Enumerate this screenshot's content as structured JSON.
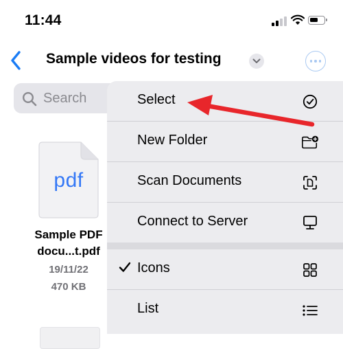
{
  "status_bar": {
    "time": "11:44"
  },
  "nav": {
    "title": "Sample videos for testing",
    "icons": {
      "back": "chevron-left-icon",
      "title_menu": "chevron-down-icon",
      "more": "ellipsis-circle-icon"
    }
  },
  "search": {
    "placeholder": "Search",
    "icon": "magnifier-icon"
  },
  "file": {
    "extension": "pdf",
    "name_line1": "Sample PDF",
    "name_line2": "docu...t.pdf",
    "date": "19/11/22",
    "size": "470 KB"
  },
  "menu": {
    "items": [
      {
        "label": "Select",
        "icon": "checkmark-circle-icon"
      },
      {
        "label": "New Folder",
        "icon": "folder-add-icon"
      },
      {
        "label": "Scan Documents",
        "icon": "document-scan-icon"
      },
      {
        "label": "Connect to Server",
        "icon": "server-display-icon"
      },
      {
        "label": "Icons",
        "icon": "grid-icon",
        "checked": true
      },
      {
        "label": "List",
        "icon": "list-icon"
      }
    ]
  },
  "colors": {
    "accent": "#3478f6",
    "annotation_arrow": "#e8262b",
    "menu_bg": "#ececef"
  }
}
